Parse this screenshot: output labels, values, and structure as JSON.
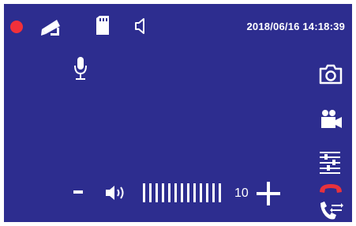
{
  "status_bar": {
    "datetime": "2018/06/16 14:18:39",
    "icons": [
      "recording-icon",
      "camera-icon",
      "sd-card-icon",
      "speaker-icon"
    ]
  },
  "volume": {
    "level": "10",
    "value": 10,
    "max": 10,
    "minus_icon": "minus-icon",
    "speaker_icon": "speaker-volume-icon",
    "plus_icon": "plus-icon"
  },
  "side_controls": [
    "snapshot-icon",
    "video-record-icon",
    "settings-sliders-icon",
    "hang-up-icon",
    "call-transfer-icon"
  ],
  "colors": {
    "background": "#2d2d8f",
    "record": "#f2303a",
    "hangup": "#e8323c",
    "foreground": "#ffffff"
  }
}
